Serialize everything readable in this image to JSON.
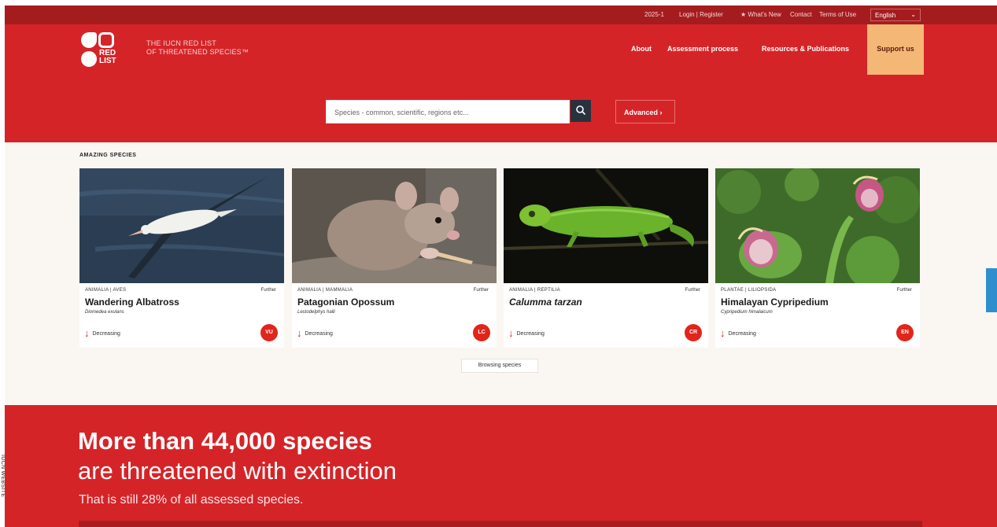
{
  "utility_bar": {
    "items": [
      "2025-1",
      "Login | Register",
      "What's New",
      "Contact",
      "Terms of Use"
    ],
    "language": "English"
  },
  "header": {
    "logo_text": "RED LIST",
    "tagline_line1": "THE IUCN RED LIST",
    "tagline_line2": "OF THREATENED SPECIES™",
    "nav": [
      "About",
      "Assessment process",
      "Resources & Publications"
    ],
    "support_label": "Support us"
  },
  "search": {
    "placeholder": "Species - common, scientific, regions etc...",
    "advanced_label": "Advanced"
  },
  "species_section": {
    "label": "AMAZING SPECIES",
    "cards": [
      {
        "group": "ANIMALIA | AVES",
        "common_name": "Wandering Albatross",
        "scientific_name": "Diomedea exulans",
        "trend": "Decreasing",
        "status": "VU",
        "further": "Further"
      },
      {
        "group": "ANIMALIA | MAMMALIA",
        "common_name": "Patagonian Opossum",
        "scientific_name": "Lestodelphys halli",
        "trend": "Decreasing",
        "status": "LC",
        "further": "Further"
      },
      {
        "group": "ANIMALIA | REPTILIA",
        "common_name": "Calumma tarzan",
        "scientific_name": "",
        "trend": "Decreasing",
        "status": "CR",
        "further": "Further"
      },
      {
        "group": "PLANTAE | LILIOPSIDA",
        "common_name": "Himalayan Cypripedium",
        "scientific_name": "Cypripedium himalaicum",
        "trend": "Decreasing",
        "status": "EN",
        "further": "Further"
      }
    ],
    "browse_label": "Browsing species"
  },
  "banner": {
    "headline": "More than 44,000 species",
    "subheadline": "are threatened with extinction",
    "note": "That is still 28% of all assessed species."
  },
  "side_credit": "IUCN WEBSITE",
  "colors": {
    "brand_red": "#d52428",
    "dark_red": "#a51c1f",
    "support_orange": "#f5b776",
    "search_button": "#28323f"
  }
}
